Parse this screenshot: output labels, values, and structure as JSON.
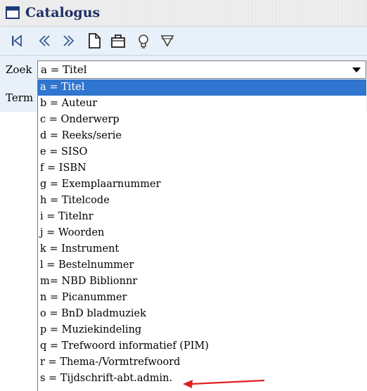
{
  "window": {
    "title": "Catalogus"
  },
  "toolbar": {
    "buttons": [
      {
        "icon": "first-record-icon"
      },
      {
        "icon": "previous-icon"
      },
      {
        "icon": "next-icon"
      },
      {
        "icon": "new-document-icon"
      },
      {
        "icon": "briefcase-icon"
      },
      {
        "icon": "lightbulb-icon"
      },
      {
        "icon": "filter-icon"
      }
    ]
  },
  "form": {
    "zoek_label": "Zoek",
    "term_label": "Term",
    "search_type": {
      "selected": "a = Titel",
      "options": [
        "a = Titel",
        "b = Auteur",
        "c = Onderwerp",
        "d = Reeks/serie",
        "e = SISO",
        "f = ISBN",
        "g = Exemplaarnummer",
        "h = Titelcode",
        "i = Titelnr",
        "j = Woorden",
        "k = Instrument",
        "l = Bestelnummer",
        "m= NBD Biblionnr",
        "n = Picanummer",
        "o = BnD bladmuziek",
        "p = Muziekindeling",
        "q = Trefwoord informatief (PIM)",
        "r = Thema-/Vormtrefwoord",
        "s = Tijdschrift-abt.admin."
      ]
    }
  },
  "colors": {
    "title_text": "#1e2f66",
    "toolbar_bg": "#e8f0f9",
    "selection_bg": "#3075cf",
    "annotation_arrow": "#e02020"
  }
}
